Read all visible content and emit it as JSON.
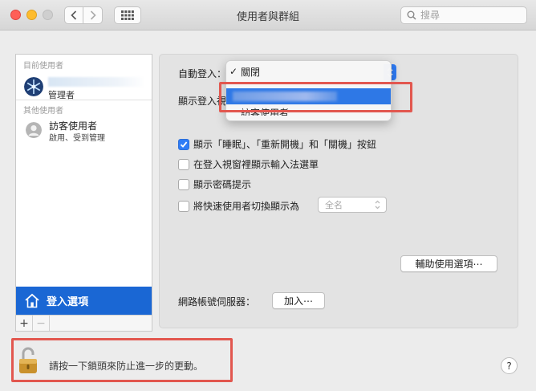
{
  "window": {
    "title": "使用者與群組"
  },
  "toolbar": {
    "search_placeholder": "搜尋"
  },
  "sidebar": {
    "current_users_label": "目前使用者",
    "current_user": {
      "name": "",
      "role": "管理者"
    },
    "other_users_label": "其他使用者",
    "guest_user": {
      "name": "訪客使用者",
      "desc": "啟用、受到管理"
    },
    "login_options_label": "登入選項",
    "add_label": "+",
    "remove_label": "−"
  },
  "main": {
    "auto_login_label": "自動登入：",
    "auto_login_value": "關閉",
    "display_login_label": "顯示登入視",
    "menu": {
      "items": [
        {
          "label": "關閉",
          "checked": true
        },
        {
          "label": "",
          "selected": true
        },
        {
          "label": "訪客使用者"
        }
      ]
    },
    "checkboxes": [
      {
        "label": "顯示「睡眠」、「重新開機」和「關機」按鈕",
        "checked": true
      },
      {
        "label": "在登入視窗裡顯示輸入法選單",
        "checked": false
      },
      {
        "label": "顯示密碼提示",
        "checked": false
      },
      {
        "label": "將快速使用者切換顯示為",
        "checked": false
      }
    ],
    "fast_switch_value": "全名",
    "accessibility_button": "輔助使用選項⋯",
    "network_server_label": "網路帳號伺服器：",
    "join_button": "加入⋯"
  },
  "footer": {
    "lock_text": "請按一下鎖頭來防止進一步的更動。",
    "help_label": "?"
  },
  "colors": {
    "accent": "#2e78e6",
    "sidebar_selected": "#1a67d4",
    "annotation": "#e2574f"
  }
}
